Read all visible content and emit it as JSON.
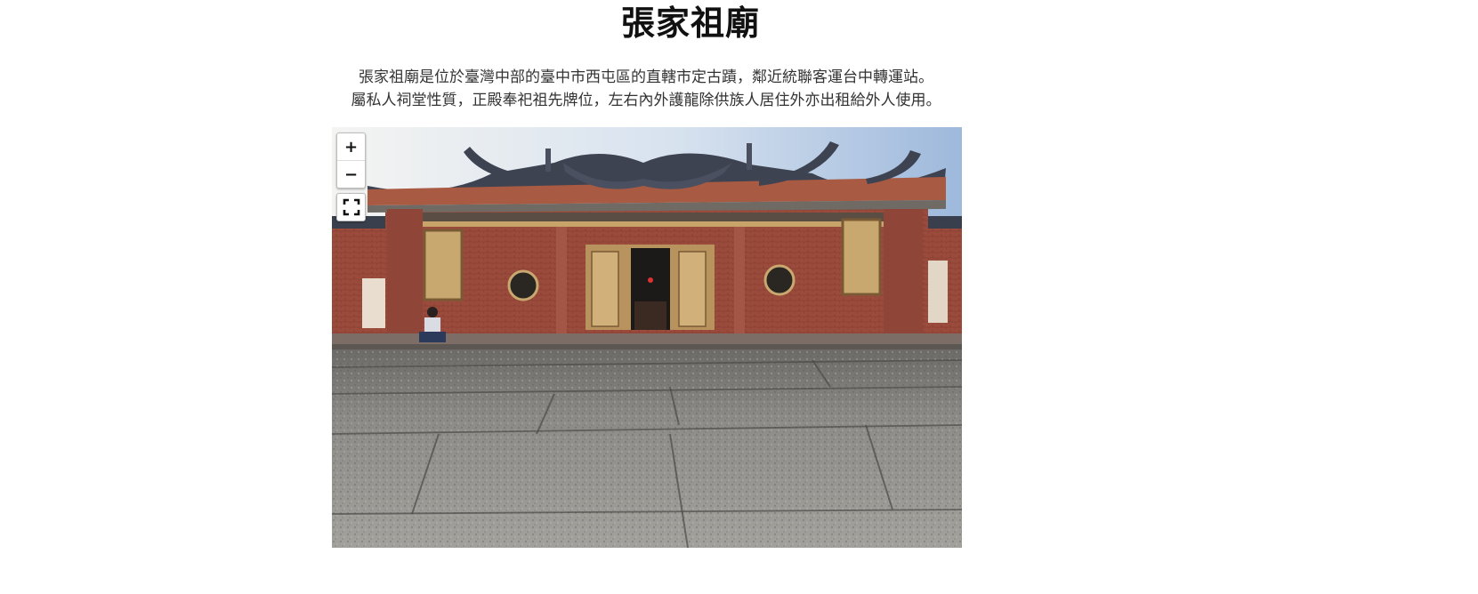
{
  "page": {
    "title": "張家祖廟",
    "description_line1": "張家祖廟是位於臺灣中部的臺中市西屯區的直轄市定古蹟，鄰近統聯客運台中轉運站。",
    "description_line2": "屬私人祠堂性質，正殿奉祀祖先牌位，左右內外護龍除供族人居住外亦出租給外人使用。"
  },
  "viewer": {
    "zoom_in_label": "+",
    "zoom_out_label": "−",
    "fullscreen_icon": "fullscreen-icon"
  },
  "colors": {
    "sky": "#8aa6cc",
    "brick": "#9a4a3c",
    "roof": "#3c4150",
    "stone": "#8a8a88"
  }
}
